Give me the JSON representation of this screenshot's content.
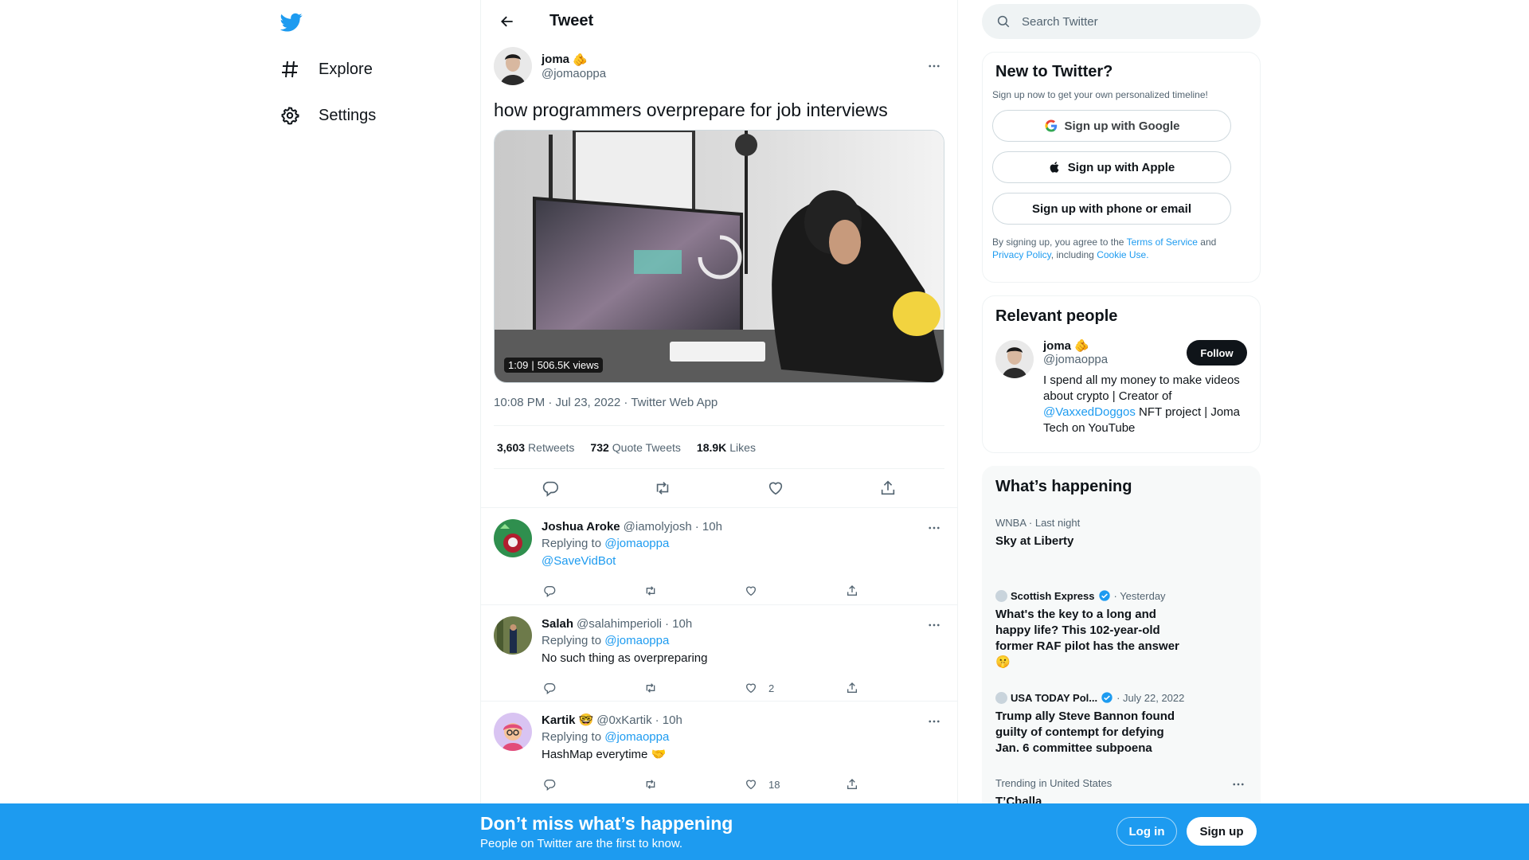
{
  "nav": {
    "items": [
      {
        "label": "Explore",
        "icon": "hashtag-icon"
      },
      {
        "label": "Settings",
        "icon": "gear-icon"
      }
    ]
  },
  "header": {
    "title": "Tweet"
  },
  "tweet": {
    "author_name": "joma",
    "author_emoji": "🫵",
    "author_handle": "@jomaoppa",
    "text": "how programmers overprepare for job interviews",
    "video_duration": "1:09",
    "video_views": "506.5K views",
    "meta": "10:08 PM · Jul 23, 2022 · Twitter Web App",
    "stats": {
      "retweets_count": "3,603",
      "retweets_label": "Retweets",
      "quotes_count": "732",
      "quotes_label": "Quote Tweets",
      "likes_count": "18.9K",
      "likes_label": "Likes"
    }
  },
  "replies": [
    {
      "name": "Joshua Aroke",
      "emoji": "",
      "handle": "@iamolyjosh",
      "time": "· 10h",
      "replying_label": "Replying to",
      "replying_to": "@jomaoppa",
      "text": "",
      "mention": "@SaveVidBot",
      "likes": ""
    },
    {
      "name": "Salah",
      "emoji": "",
      "handle": "@salahimperioli",
      "time": "· 10h",
      "replying_label": "Replying to",
      "replying_to": "@jomaoppa",
      "text": "No such thing as overpreparing",
      "mention": "",
      "likes": "2"
    },
    {
      "name": "Kartik",
      "emoji": "🤓",
      "handle": "@0xKartik",
      "time": "· 10h",
      "replying_label": "Replying to",
      "replying_to": "@jomaoppa",
      "text": "HashMap everytime 🤝",
      "mention": "",
      "likes": "18"
    }
  ],
  "sidebar": {
    "search_placeholder": "Search Twitter",
    "new_to_twitter": {
      "title": "New to Twitter?",
      "subtitle": "Sign up now to get your own personalized timeline!",
      "google_label": "Sign up with Google",
      "apple_label": "Sign up with Apple",
      "phone_label": "Sign up with phone or email",
      "terms_prefix": "By signing up, you agree to the",
      "terms_link": "Terms of Service",
      "terms_and": "and",
      "privacy_link": "Privacy Policy",
      "terms_including": ", including",
      "cookie_link": "Cookie Use."
    },
    "relevant_people": {
      "title": "Relevant people",
      "name": "joma",
      "emoji": "🫵",
      "handle": "@jomaoppa",
      "follow_label": "Follow",
      "bio_1": "I spend all my money to make videos about crypto | Creator of",
      "bio_link": "@VaxxedDoggos",
      "bio_2": "NFT project | Joma Tech on YouTube"
    },
    "whats_happening": {
      "title": "What’s happening",
      "trends": [
        {
          "context": "WNBA · Last night",
          "title": "Sky at Liberty"
        },
        {
          "source": "Scottish Express",
          "time": "· Yesterday",
          "title": "What's the key to a long and happy life? This 102-year-old former RAF pilot has the answer 🤫"
        },
        {
          "source": "USA TODAY Pol...",
          "time": "· July 22, 2022",
          "title": "Trump ally Steve Bannon found guilty of contempt for defying Jan. 6 committee subpoena"
        },
        {
          "context": "Trending in United States",
          "title": "T’Challa"
        }
      ]
    }
  },
  "bottom_bar": {
    "title": "Don’t miss what’s happening",
    "subtitle": "People on Twitter are the first to know.",
    "login_label": "Log in",
    "signup_label": "Sign up"
  },
  "colors": {
    "accent": "#1d9bf0",
    "text": "#0f1419",
    "muted": "#536471"
  }
}
